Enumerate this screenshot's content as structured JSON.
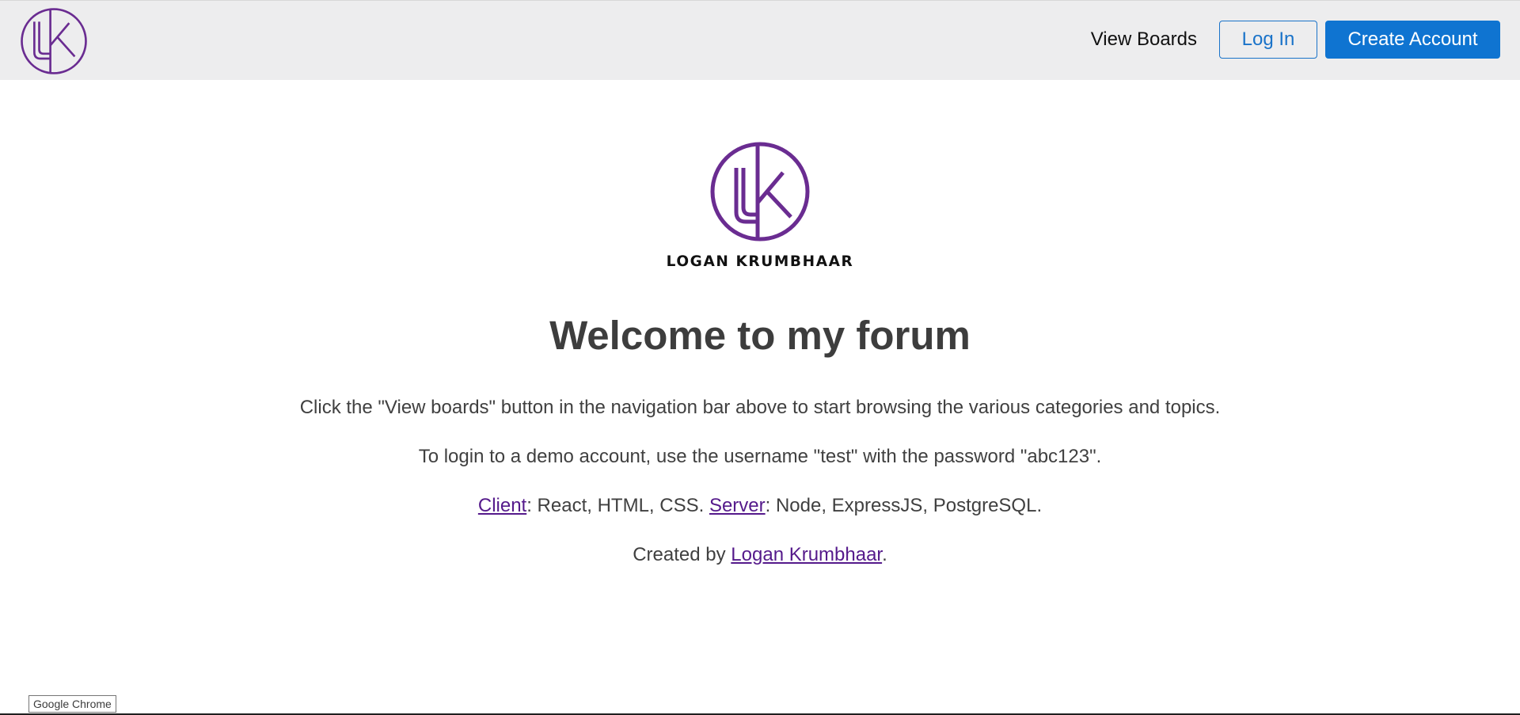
{
  "header": {
    "logo_icon": "lk-monogram-icon",
    "view_boards": "View Boards",
    "log_in": "Log In",
    "create_account": "Create Account"
  },
  "hero": {
    "logo_icon": "lk-monogram-icon",
    "logo_text": "LOGAN KRUMBHAAR",
    "title": "Welcome to my forum"
  },
  "content": {
    "p1": "Click the \"View boards\" button in the navigation bar above to start browsing the various categories and topics.",
    "p2": "To login to a demo account, use the username \"test\" with the password \"abc123\".",
    "p3_client_link": "Client",
    "p3_client_text": ": React, HTML, CSS. ",
    "p3_server_link": "Server",
    "p3_server_text": ": Node, ExpressJS, PostgreSQL.",
    "p4_prefix": "Created by ",
    "p4_link": "Logan Krumbhaar",
    "p4_suffix": "."
  },
  "tooltip": {
    "text": "Google Chrome"
  },
  "colors": {
    "brand_purple": "#6a2c91",
    "primary_blue": "#0f74d1",
    "visited_link": "#551a8b",
    "navbar_bg": "#ededee"
  }
}
